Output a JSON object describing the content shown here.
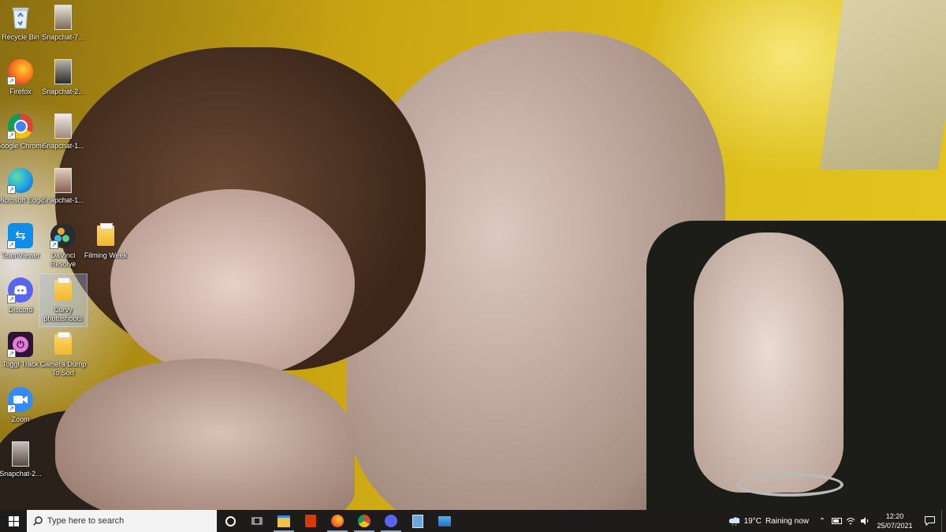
{
  "desktop": {
    "icons": [
      {
        "label": "Recycle Bin",
        "icon": "recycle-bin-icon"
      },
      {
        "label": "Snapchat-7...",
        "icon": "image-thumbnail-icon"
      },
      {
        "label": "Firefox",
        "icon": "firefox-icon"
      },
      {
        "label": "Snapchat-2...",
        "icon": "image-thumbnail-icon"
      },
      {
        "label": "Google Chrome",
        "icon": "chrome-icon"
      },
      {
        "label": "Snapchat-1...",
        "icon": "image-thumbnail-icon"
      },
      {
        "label": "Microsoft Edge",
        "icon": "edge-icon"
      },
      {
        "label": "Snapchat-1...",
        "icon": "image-thumbnail-icon"
      },
      {
        "label": "TeamViewer",
        "icon": "teamviewer-icon"
      },
      {
        "label": "DaVinci Resolve",
        "icon": "davinci-resolve-icon"
      },
      {
        "label": "Filming Week",
        "icon": "folder-icon"
      },
      {
        "label": "Discord",
        "icon": "discord-icon"
      },
      {
        "label": "Curvy photoshoots",
        "icon": "folder-icon"
      },
      {
        "label": "Toggl Track",
        "icon": "toggl-track-icon"
      },
      {
        "label": "Camera Dump To Sort",
        "icon": "folder-icon"
      },
      {
        "label": "Zoom",
        "icon": "zoom-icon"
      },
      {
        "label": "Snapchat-2...",
        "icon": "image-thumbnail-icon"
      }
    ]
  },
  "taskbar": {
    "search_placeholder": "Type here to search",
    "pinned": [
      {
        "name": "file-explorer",
        "icon": "file-explorer-icon"
      },
      {
        "name": "office",
        "icon": "office-icon"
      },
      {
        "name": "firefox",
        "icon": "firefox-icon"
      },
      {
        "name": "chrome",
        "icon": "chrome-icon"
      },
      {
        "name": "discord",
        "icon": "discord-icon"
      },
      {
        "name": "calculator",
        "icon": "calculator-icon"
      },
      {
        "name": "photos",
        "icon": "photos-icon"
      }
    ],
    "weather": {
      "temp": "19°C",
      "condition": "Raining now"
    },
    "clock": {
      "time": "12:20",
      "date": "25/07/2021"
    }
  },
  "colors": {
    "taskbar_bg": "#1d1c1a",
    "search_bg": "#f3f3f3",
    "accent": "#7aa7e0"
  }
}
